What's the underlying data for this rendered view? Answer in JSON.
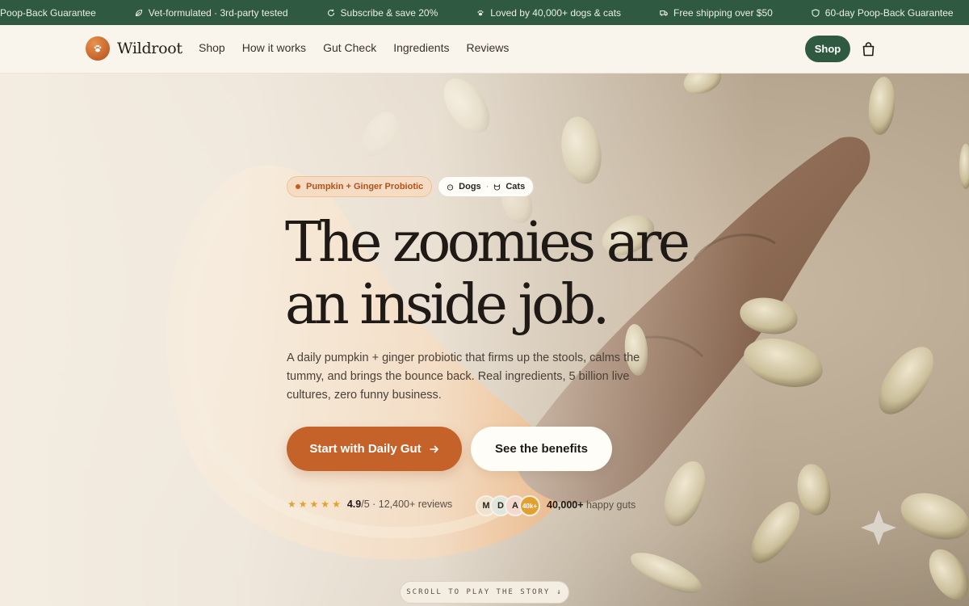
{
  "announcements": [
    {
      "icon": "shield-icon",
      "text": "60-day Poop-Back Guarantee"
    },
    {
      "icon": "leaf-icon",
      "text": "Vet-formulated · 3rd-party tested"
    },
    {
      "icon": "refresh-icon",
      "text": "Subscribe & save 20%"
    },
    {
      "icon": "paw-icon",
      "text": "Loved by 40,000+ dogs & cats"
    },
    {
      "icon": "truck-icon",
      "text": "Free shipping over $50"
    },
    {
      "icon": "shield-icon",
      "text": "60-day Poop-Back Guarantee"
    }
  ],
  "nav": {
    "brand": "Wildroot",
    "links": [
      "Shop",
      "How it works",
      "Gut Check",
      "Ingredients",
      "Reviews"
    ],
    "shop_button": "Shop",
    "cart_icon": "shopping-bag-icon"
  },
  "hero": {
    "badge": "Pumpkin + Ginger Probiotic",
    "species": {
      "dogs": "Dogs",
      "separator": "·",
      "cats": "Cats"
    },
    "headline_line1": "The zoomies are",
    "headline_line2": "an inside job.",
    "subtext": "A daily pumpkin + ginger probiotic that firms up the stools, calms the tummy, and brings the bounce back. Real ingredients, 5 billion live cultures, zero funny business.",
    "primary_cta": "Start with Daily Gut",
    "secondary_cta": "See the benefits",
    "rating": {
      "stars": 5,
      "score": "4.9",
      "scale": "/5",
      "reviews": "· 12,400+ reviews"
    },
    "avatars": [
      {
        "initial": "M",
        "color": "#efe3cf"
      },
      {
        "initial": "D",
        "color": "#dfe6db"
      },
      {
        "initial": "A",
        "color": "#f3d9cf"
      },
      {
        "initial": "40k+",
        "color": "#e2a12f"
      }
    ],
    "happy_count": "40,000+",
    "happy_label": "happy guts",
    "scroll_hint": "SCROLL TO PLAY THE STORY",
    "scroll_arrow": "↓"
  },
  "colors": {
    "brand_green": "#2f5a41",
    "brand_orange": "#c4622a",
    "cream": "#f6efe4",
    "star": "#e2a12f"
  }
}
